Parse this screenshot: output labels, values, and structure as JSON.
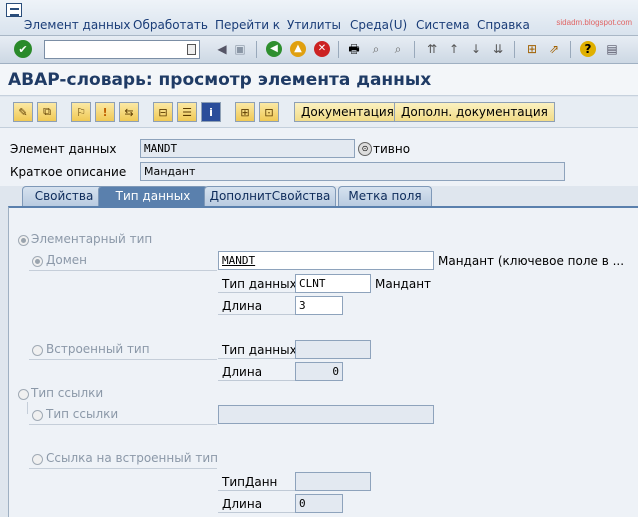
{
  "menu": {
    "items": [
      "Элемент данных",
      "Обработать",
      "Перейти к",
      "Утилиты",
      "Среда(U)",
      "Система",
      "Справка"
    ],
    "watermark": "sidadm.blogspot.com"
  },
  "title": "ABAP-словарь: просмотр элемента данных",
  "app_toolbar": {
    "doc_button": "Документация",
    "extra_doc_button": "Дополн. документация"
  },
  "header": {
    "element_label": "Элемент данных",
    "element_value": "MANDT",
    "element_status": "тивно",
    "short_desc_label": "Краткое описание",
    "short_desc_value": "Мандант"
  },
  "tabs": [
    "Свойства",
    "Тип данных",
    "ДополнитСвойства",
    "Метка поля"
  ],
  "active_tab": 1,
  "content": {
    "elementary_type": "Элементарный тип",
    "domain_label": "Домен",
    "domain_value": "MANDT",
    "domain_desc": "Мандант (ключевое поле в ...",
    "dtype_label": "Тип данных",
    "dtype_value": "CLNT",
    "dtype_desc": "Мандант",
    "length_label": "Длина",
    "length_value": "3",
    "builtin_type": "Встроенный тип",
    "builtin_dtype_label": "Тип данных",
    "builtin_dtype_value": "",
    "builtin_length_label": "Длина",
    "builtin_length_value": "0",
    "ref_type": "Тип ссылки",
    "ref_type_sub": "Тип ссылки",
    "ref_type_value": "",
    "ref_builtin": "Ссылка на встроенный тип",
    "ref_dtype_label": "ТипДанн",
    "ref_dtype_value": "",
    "ref_length_label": "Длина",
    "ref_length_value": "0"
  }
}
